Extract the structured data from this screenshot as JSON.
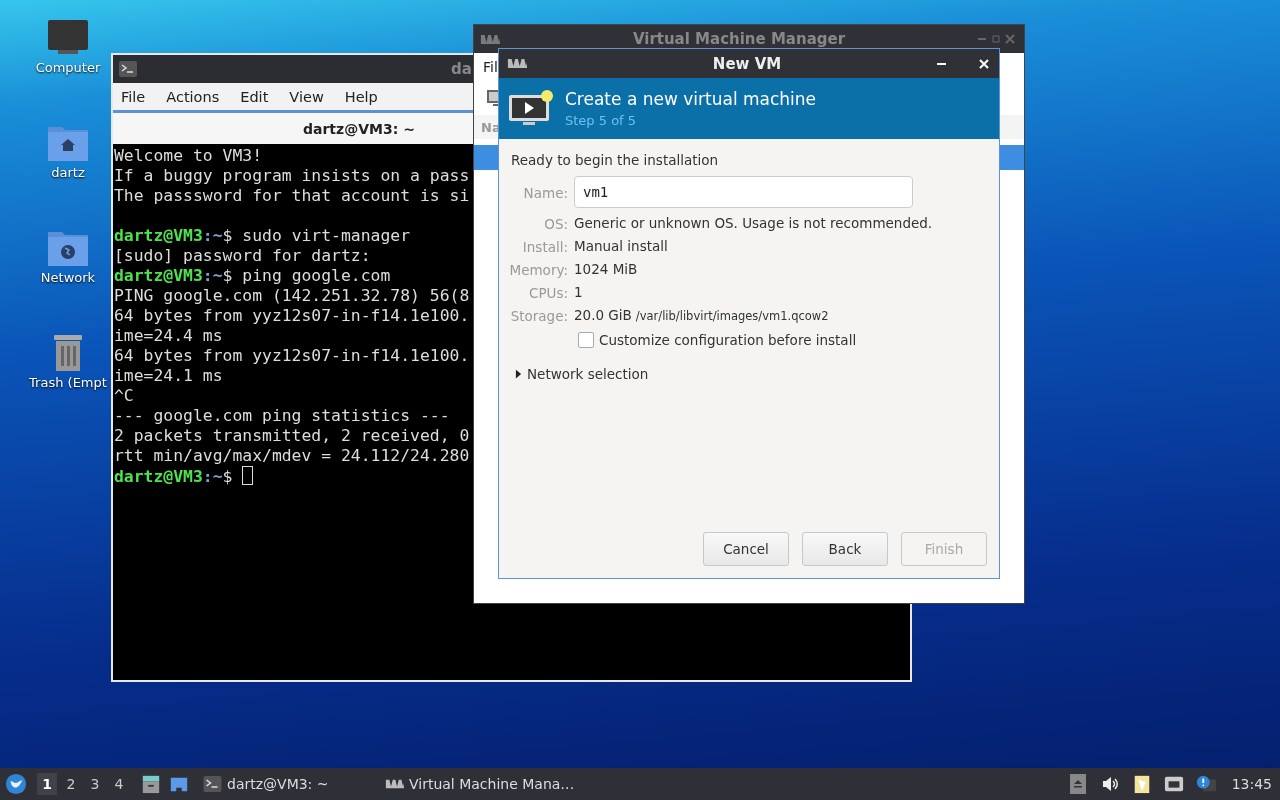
{
  "desktop_icons": [
    {
      "label": "Computer",
      "kind": "computer"
    },
    {
      "label": "dartz",
      "kind": "home"
    },
    {
      "label": "Network",
      "kind": "network"
    },
    {
      "label": "Trash (Empt",
      "kind": "trash"
    }
  ],
  "terminal": {
    "title": "da",
    "menu": [
      "File",
      "Actions",
      "Edit",
      "View",
      "Help"
    ],
    "tab_title": "dartz@VM3: ~",
    "lines": [
      {
        "kind": "output",
        "text": "Welcome to VM3!"
      },
      {
        "kind": "output",
        "text": "If a buggy program insists on a pass"
      },
      {
        "kind": "output",
        "text": "The passsword for that account is si"
      },
      {
        "kind": "blank"
      },
      {
        "kind": "prompt",
        "user": "dartz@VM3",
        "path": ":~",
        "text": "$ sudo virt-manager"
      },
      {
        "kind": "output",
        "text": "[sudo] password for dartz:"
      },
      {
        "kind": "prompt",
        "user": "dartz@VM3",
        "path": ":~",
        "text": "$ ping google.com"
      },
      {
        "kind": "output",
        "text": "PING google.com (142.251.32.78) 56(8"
      },
      {
        "kind": "output",
        "text": "64 bytes from yyz12s07-in-f14.1e100."
      },
      {
        "kind": "output",
        "text": "ime=24.4 ms"
      },
      {
        "kind": "output",
        "text": "64 bytes from yyz12s07-in-f14.1e100."
      },
      {
        "kind": "output",
        "text": "ime=24.1 ms"
      },
      {
        "kind": "output",
        "text": "^C"
      },
      {
        "kind": "output",
        "text": "--- google.com ping statistics ---"
      },
      {
        "kind": "output",
        "text": "2 packets transmitted, 2 received, 0"
      },
      {
        "kind": "output",
        "text": "rtt min/avg/max/mdev = 24.112/24.280"
      },
      {
        "kind": "prompt",
        "user": "dartz@VM3",
        "path": ":~",
        "text": "$ ",
        "cursor": true
      }
    ]
  },
  "manager": {
    "title": "Virtual Machine Manager",
    "menu_partial": "Fil",
    "column_partial": "Na"
  },
  "dialog": {
    "title": "New VM",
    "heading": "Create a new virtual machine",
    "step": "Step 5 of 5",
    "intro": "Ready to begin the installation",
    "name_field": {
      "label": "Name:",
      "value": "vm1"
    },
    "details": [
      {
        "label": "OS:",
        "value": "Generic or unknown OS. Usage is not recommended."
      },
      {
        "label": "Install:",
        "value": "Manual install"
      },
      {
        "label": "Memory:",
        "value": "1024 MiB"
      },
      {
        "label": "CPUs:",
        "value": "1"
      },
      {
        "label": "Storage:",
        "value": "20.0 GiB",
        "path": "/var/lib/libvirt/images/vm1.qcow2"
      }
    ],
    "checkbox": {
      "label": "Customize configuration before install",
      "checked": false
    },
    "expander": {
      "label": "Network selection",
      "expanded": false
    },
    "buttons": [
      {
        "label": "Cancel",
        "disabled": false
      },
      {
        "label": "Back",
        "disabled": false
      },
      {
        "label": "Finish",
        "disabled": true
      }
    ]
  },
  "taskbar": {
    "workspaces": [
      {
        "label": "1",
        "selected": true
      },
      {
        "label": "2",
        "selected": false
      },
      {
        "label": "3",
        "selected": false
      },
      {
        "label": "4",
        "selected": false
      }
    ],
    "tasks": [
      {
        "label": "dartz@VM3: ~",
        "kind": "terminal"
      },
      {
        "label": "Virtual Machine Mana…",
        "kind": "vmm"
      }
    ],
    "clock": "13:45"
  }
}
